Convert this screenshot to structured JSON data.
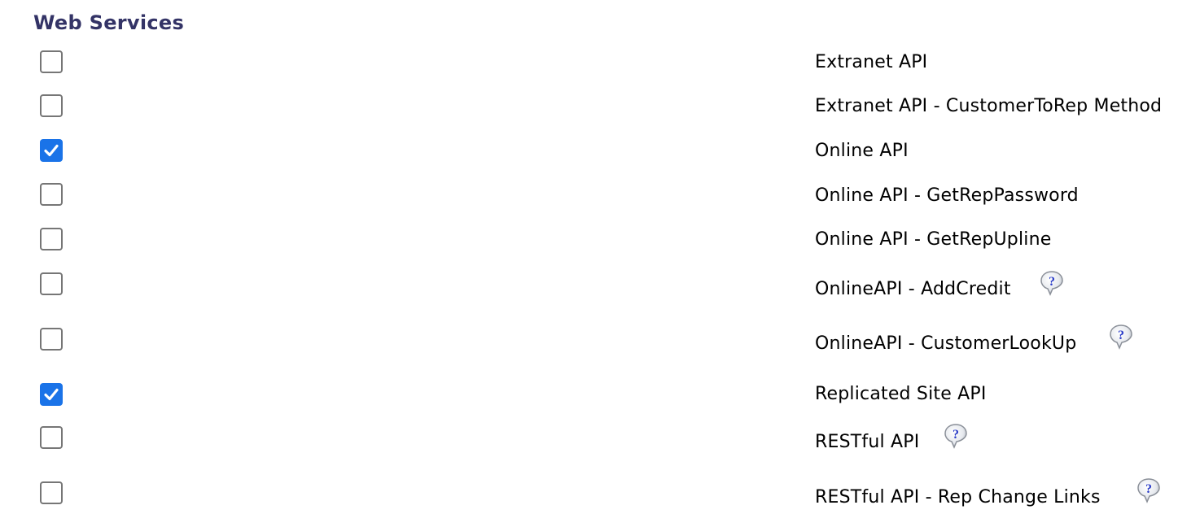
{
  "section": {
    "title": "Web Services"
  },
  "items": [
    {
      "label": "Extranet API",
      "checked": false,
      "help": false
    },
    {
      "label": "Extranet API - CustomerToRep Method",
      "checked": false,
      "help": false
    },
    {
      "label": "Online API",
      "checked": true,
      "help": false
    },
    {
      "label": "Online API - GetRepPassword",
      "checked": false,
      "help": false
    },
    {
      "label": "Online API - GetRepUpline",
      "checked": false,
      "help": false
    },
    {
      "label": "OnlineAPI - AddCredit",
      "checked": false,
      "help": true
    },
    {
      "label": "OnlineAPI - CustomerLookUp",
      "checked": false,
      "help": true
    },
    {
      "label": "Replicated Site API",
      "checked": true,
      "help": false
    },
    {
      "label": "RESTful API",
      "checked": false,
      "help": true
    },
    {
      "label": "RESTful API - Rep Change Links",
      "checked": false,
      "help": true
    }
  ],
  "colors": {
    "title": "#333366",
    "checkbox_checked": "#1a73e8",
    "checkbox_border": "#767676"
  },
  "icons": {
    "help": "help-question-icon",
    "check": "checkmark-icon"
  }
}
